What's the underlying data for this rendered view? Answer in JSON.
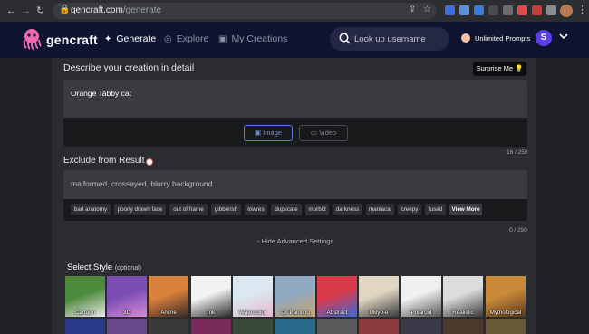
{
  "browser": {
    "url_host": "gencraft.com",
    "url_path": "/generate",
    "nav_back": "←",
    "nav_forward": "→",
    "reload": "↻",
    "lock": "🔒",
    "share": "⇪",
    "star": "☆",
    "menu": "⋮",
    "extension_colors": [
      "#3f6ed8",
      "#5a8ee0",
      "#3a7bd5",
      "#4a4b4f",
      "#6b6c70",
      "#e24a4a",
      "#c83c3c",
      "#8a8b8f"
    ]
  },
  "header": {
    "brand": "gencraft",
    "nav": [
      {
        "label": "Generate",
        "icon": "sparkle-icon",
        "glyph": "✦",
        "active": true
      },
      {
        "label": "Explore",
        "icon": "explore-icon",
        "glyph": "◎",
        "active": false
      },
      {
        "label": "My Creations",
        "icon": "gallery-icon",
        "glyph": "▣",
        "active": false
      }
    ],
    "search_placeholder": "Look up username",
    "plan": "Unlimited Prompts",
    "user_initial": "S",
    "colors": {
      "bg": "#0f1430",
      "accent": "#5a3ee6"
    }
  },
  "creation": {
    "title": "Describe your creation in detail",
    "surprise": "Surprise Me 💡",
    "prompt": "Orange Tabby cat",
    "image_btn": "Image",
    "video_btn": "Video",
    "counter": "16 / 250"
  },
  "exclude": {
    "title": "Exclude from Result",
    "text": "malformed, crosseyed, blurry background",
    "chips": [
      "bad anatomy",
      "poorly drawn face",
      "out of frame",
      "gibberish",
      "lowres",
      "duplicate",
      "morbid",
      "darkness",
      "maniacal",
      "creepy",
      "fused",
      "View More"
    ],
    "counter": "0 / 250"
  },
  "advanced": "- Hide Advanced Settings",
  "styles": {
    "title": "Select Style",
    "optional": "(optional)",
    "items": [
      {
        "label": "Cartoon",
        "colors": [
          "#4d8a3c",
          "#eaeaea"
        ]
      },
      {
        "label": "3D",
        "colors": [
          "#7a4db3",
          "#d98ad9"
        ]
      },
      {
        "label": "Anime",
        "colors": [
          "#d9823b",
          "#3a2a28"
        ]
      },
      {
        "label": "Ink",
        "colors": [
          "#f2f2f2",
          "#2a2a2a"
        ]
      },
      {
        "label": "Watercolor",
        "colors": [
          "#dbe8f2",
          "#e6b8cc"
        ]
      },
      {
        "label": "Oil Painting",
        "colors": [
          "#8fa9c0",
          "#c9a26b"
        ]
      },
      {
        "label": "Abstract",
        "colors": [
          "#d93a4a",
          "#3a6ad9"
        ]
      },
      {
        "label": "Ukiyo-e",
        "colors": [
          "#e0d6c2",
          "#3a3a3a"
        ]
      },
      {
        "label": "Polaroid",
        "colors": [
          "#f0f0f0",
          "#555555"
        ]
      },
      {
        "label": "Realistic",
        "colors": [
          "#dcdcdc",
          "#3a3a3a"
        ]
      },
      {
        "label": "Mythological",
        "colors": [
          "#c98a3a",
          "#5a3a1a"
        ]
      }
    ],
    "row2_colors": [
      "#2a3a8a",
      "#6a4a8a",
      "#3a3a3a",
      "#7a2a5a",
      "#3a4a3a",
      "#2a6a8a",
      "#5a5a5a",
      "#8a3a3a",
      "#3a3a4a",
      "#4a3a2a",
      "#6a5a3a"
    ]
  }
}
